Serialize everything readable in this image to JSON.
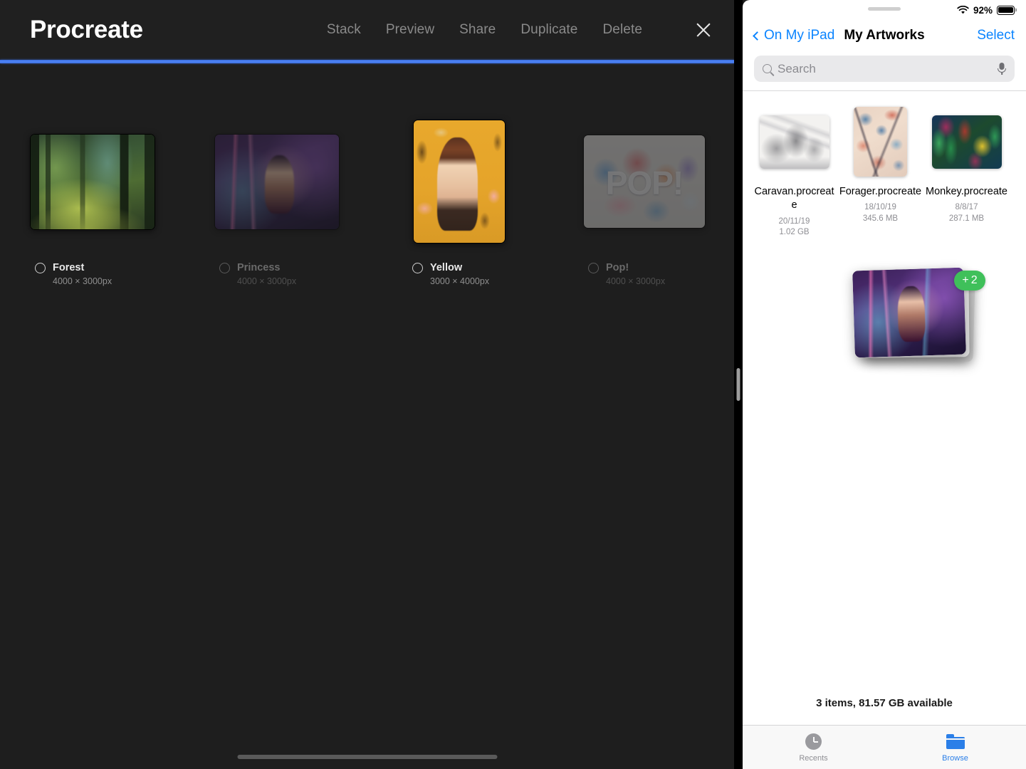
{
  "procreate": {
    "app_title": "Procreate",
    "menu": [
      {
        "label": "Stack"
      },
      {
        "label": "Preview"
      },
      {
        "label": "Share"
      },
      {
        "label": "Duplicate"
      },
      {
        "label": "Delete"
      }
    ],
    "close_icon": "close-icon",
    "artworks": [
      {
        "name": "Forest",
        "dimensions": "4000 × 3000px",
        "selected": false,
        "dimmed": false
      },
      {
        "name": "Princess",
        "dimensions": "4000 × 3000px",
        "selected": false,
        "dimmed": true
      },
      {
        "name": "Yellow",
        "dimensions": "3000 × 4000px",
        "selected": false,
        "dimmed": false
      },
      {
        "name": "Pop!",
        "dimensions": "4000 × 3000px",
        "selected": false,
        "dimmed": true
      }
    ],
    "pop_thumb_text": "POP!",
    "accent_line_color": "#3d6fe0"
  },
  "files": {
    "status": {
      "wifi_icon": "wifi-icon",
      "battery_percent": "92%",
      "battery_icon": "battery-icon"
    },
    "nav": {
      "back_label": "On My iPad",
      "back_icon": "chevron-left-icon",
      "title": "My Artworks",
      "select_label": "Select"
    },
    "search": {
      "placeholder": "Search",
      "search_icon": "search-icon",
      "mic_icon": "microphone-icon"
    },
    "items": [
      {
        "name": "Caravan.procreate",
        "date": "20/11/19",
        "size": "1.02 GB"
      },
      {
        "name": "Forager.procreate",
        "date": "18/10/19",
        "size": "345.6 MB"
      },
      {
        "name": "Monkey.procreate",
        "date": "8/8/17",
        "size": "287.1 MB"
      }
    ],
    "drag": {
      "badge_plus": "+",
      "badge_count": "2",
      "badge_color": "#3fc05a"
    },
    "footer_status": "3 items, 81.57 GB available",
    "tabs": [
      {
        "label": "Recents",
        "icon": "clock-icon",
        "active": false
      },
      {
        "label": "Browse",
        "icon": "folder-icon",
        "active": true
      }
    ]
  }
}
